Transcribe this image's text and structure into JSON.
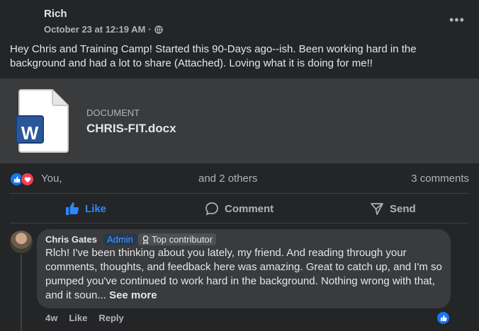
{
  "post": {
    "author": "Rich",
    "timestamp": "October 23 at 12:19 AM",
    "separator": "·",
    "audience_icon": "globe-icon",
    "more_label": "•••",
    "text": "Hey Chris and Training Camp! Started this 90-Days ago--ish. Been working hard in the background and had a lot to share (Attached). Loving what it is doing for me!!"
  },
  "attachment": {
    "icon": "word-document-icon",
    "icon_letter": "W",
    "type_label": "DOCUMENT",
    "file_name": "CHRIS-FIT.docx"
  },
  "reactions": {
    "icons": [
      "like-reaction-icon",
      "love-reaction-icon"
    ],
    "you_label": "You,",
    "others_label": "and 2 others",
    "comments_label": "3 comments"
  },
  "actions": {
    "like": "Like",
    "comment": "Comment",
    "send": "Send"
  },
  "comment": {
    "author": "Chris Gates",
    "admin_badge": "Admin",
    "top_badge": "Top contributor",
    "text": "Rlch! I've been thinking about you lately, my friend. And reading through your comments, thoughts, and feedback here was amazing. Great to catch up, and I'm so pumped you've continued to work hard in the background. Nothing wrong with that, and it soun...",
    "see_more": "See more",
    "age": "4w",
    "like_label": "Like",
    "reply_label": "Reply"
  },
  "colors": {
    "background": "#242526",
    "attachment_bg": "#3a3b3c",
    "accent": "#2d88ff",
    "word_blue": "#2b579a"
  }
}
